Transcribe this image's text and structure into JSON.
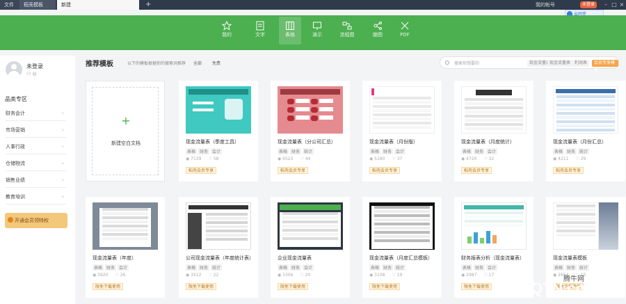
{
  "tabs": [
    {
      "label": "文件"
    },
    {
      "label": "稻壳模板"
    },
    {
      "label": "新建"
    }
  ],
  "top_right": {
    "user_text": "我的帐号",
    "login": "未登录",
    "cloud": "云同步"
  },
  "nav": [
    {
      "label": "我的",
      "icon": "star-icon"
    },
    {
      "label": "文字",
      "icon": "doc-icon"
    },
    {
      "label": "表格",
      "icon": "table-icon"
    },
    {
      "label": "演示",
      "icon": "slides-icon"
    },
    {
      "label": "流程图",
      "icon": "flow-icon"
    },
    {
      "label": "脑图",
      "icon": "mindmap-icon"
    },
    {
      "label": "PDF",
      "icon": "pdf-icon"
    }
  ],
  "sidebar": {
    "username": "未登录",
    "category_title": "品类专区",
    "items": [
      {
        "label": "财务会计"
      },
      {
        "label": "市场营销"
      },
      {
        "label": "人事行政"
      },
      {
        "label": "仓储物流"
      },
      {
        "label": "销售业绩"
      },
      {
        "label": "教育培训"
      }
    ],
    "vip_button": "开通会员领特权"
  },
  "main": {
    "title": "推荐模板",
    "subtitle": "以下的模板根据你的搜索词推荐",
    "filters": [
      "全部",
      "免费"
    ]
  },
  "search": {
    "placeholder": "搜索你想要的",
    "pills": [
      "现金流量表",
      "现金流量表",
      "利润表",
      "会员专享模板"
    ]
  },
  "blank_card": {
    "label": "新建空白文档"
  },
  "cards": [
    {
      "title": "现金流量表（季度工具）",
      "tags": [
        "表格",
        "财务",
        "会计"
      ],
      "views": "7139",
      "likes": "58",
      "badge": "稻壳会员专享",
      "thumb": "teal"
    },
    {
      "title": "现金流量表（分公司汇总）",
      "tags": [
        "表格",
        "财务",
        "统计"
      ],
      "views": "6523",
      "likes": "44",
      "badge": "稻壳会员专享",
      "thumb": "rose"
    },
    {
      "title": "现金流量表（月份版）",
      "tags": [
        "表格",
        "财务",
        "会计"
      ],
      "views": "5180",
      "likes": "37",
      "badge": "稻壳会员专享",
      "thumb": "gridwhite"
    },
    {
      "title": "现金流量表（月度统计）",
      "tags": [
        "表格",
        "财务",
        "会计"
      ],
      "views": "4720",
      "likes": "32",
      "badge": "稻壳会员专享",
      "thumb": "white1"
    },
    {
      "title": "现金流量表（月份汇总）",
      "tags": [
        "表格",
        "财务",
        "统计"
      ],
      "views": "4211",
      "likes": "29",
      "badge": "稻壳会员专享",
      "thumb": "white2"
    },
    {
      "title": "现金流量表（年度）",
      "tags": [
        "表格",
        "财务",
        "会计"
      ],
      "views": "3920",
      "likes": "26",
      "badge": "限免下载使用",
      "thumb": "gray"
    },
    {
      "title": "公司现金流量表（年度统计表）",
      "tags": [
        "表格",
        "财务",
        "统计"
      ],
      "views": "3512",
      "likes": "22",
      "badge": "限免下载使用",
      "thumb": "darkgrid"
    },
    {
      "title": "企业现金流量表",
      "tags": [
        "表格",
        "财务",
        "会计"
      ],
      "views": "3306",
      "likes": "20",
      "badge": "限免下载使用",
      "thumb": "greenhead"
    },
    {
      "title": "现金流量表（月度汇总模板）",
      "tags": [
        "表格",
        "财务",
        "统计"
      ],
      "views": "3108",
      "likes": "19",
      "badge": "限免下载使用",
      "thumb": "black"
    },
    {
      "title": "财务报表分析（现金流量表）",
      "tags": [
        "表格",
        "财务",
        "会计"
      ],
      "views": "2987",
      "likes": "17",
      "badge": "限免下载使用",
      "thumb": "chart"
    },
    {
      "title": "现金流量表模板",
      "tags": [
        "表格",
        "财务",
        "统计"
      ],
      "views": "2654",
      "likes": "15",
      "badge": "限免下载使用",
      "thumb": "photo"
    }
  ],
  "watermark": {
    "text": "QQTN.com",
    "brand": "腾牛网"
  }
}
